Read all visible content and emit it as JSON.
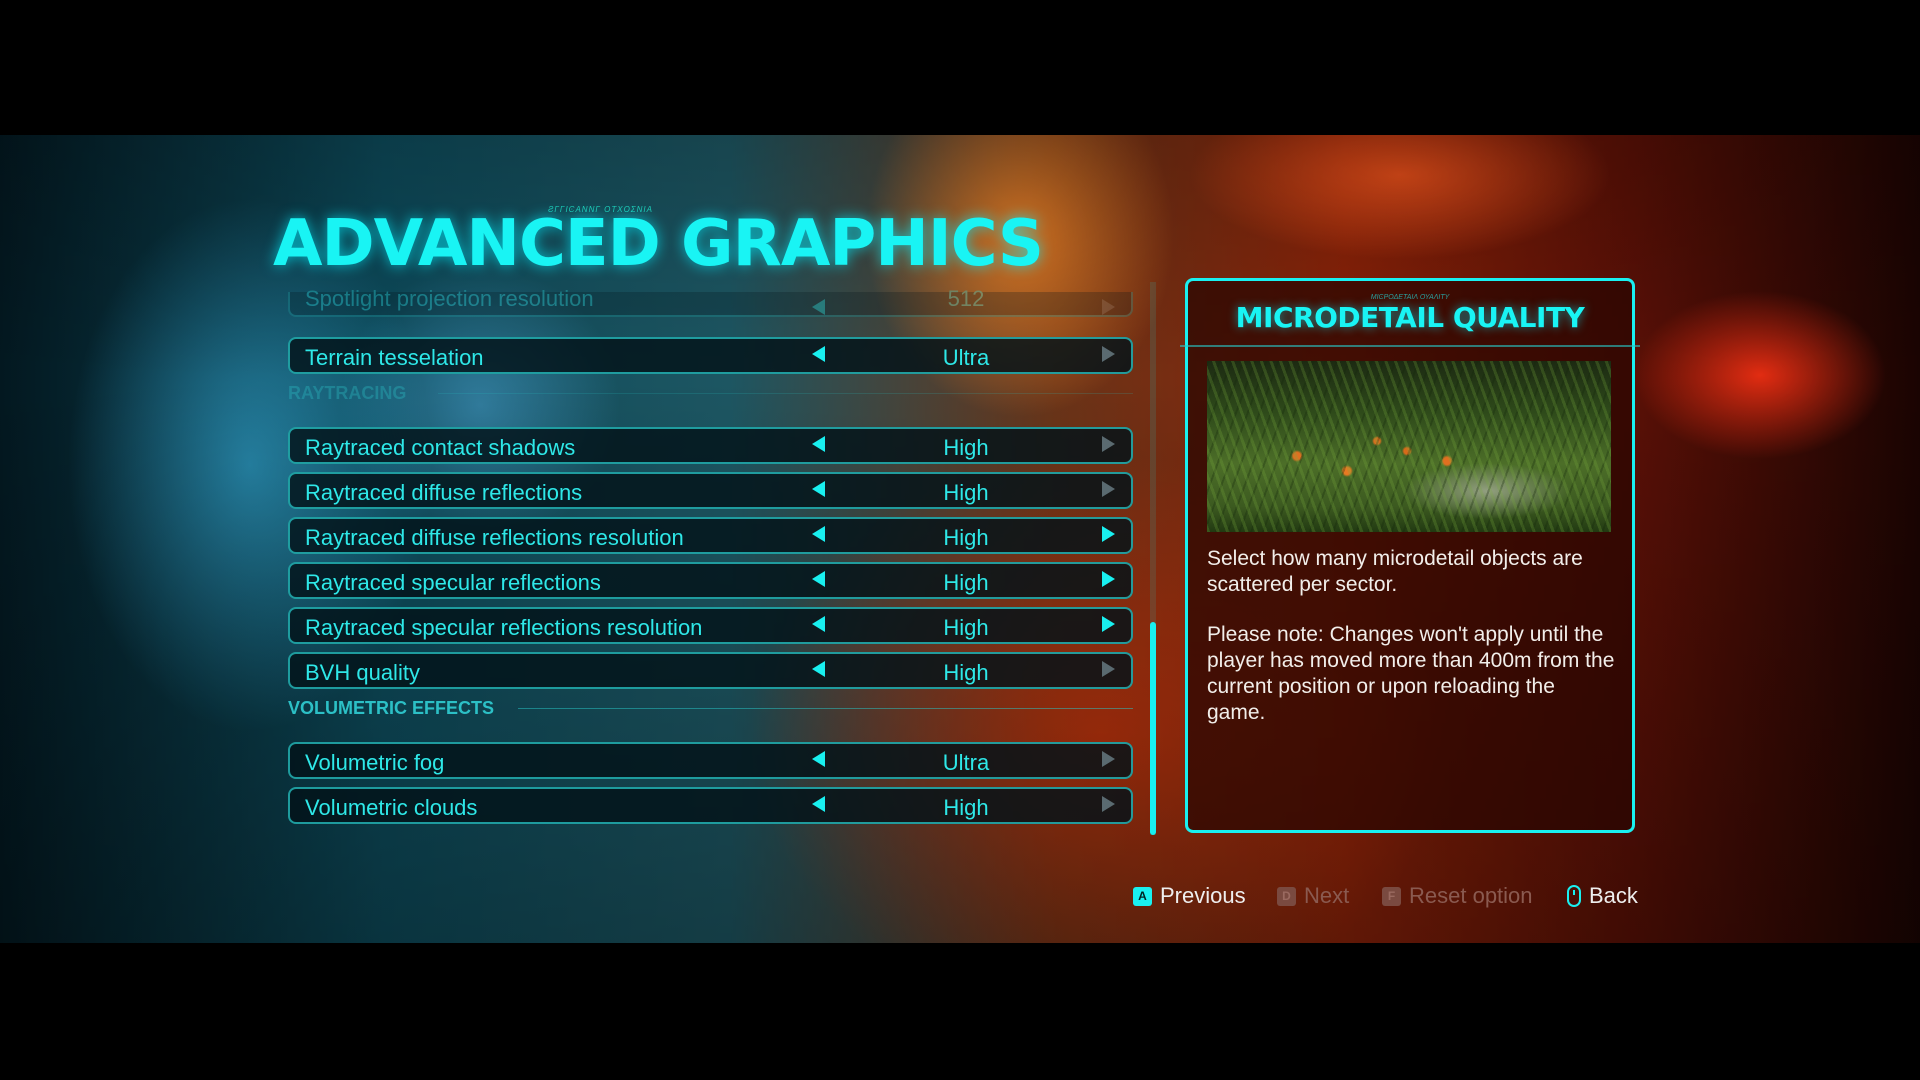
{
  "header": {
    "title": "ADVANCED GRAPHICS",
    "subtitle_glyphs": "ƧΓΓΙϾΑΝΝΓ ΟΤΧΟΣΝΙΑ"
  },
  "settings": {
    "partial_row": {
      "label": "Spotlight projection resolution",
      "value": "512"
    },
    "top_rows": [
      {
        "label": "Terrain tesselation",
        "value": "Ultra",
        "right_enabled": false
      }
    ],
    "sections": [
      {
        "title": "RAYTRACING",
        "rows": [
          {
            "label": "Raytraced contact shadows",
            "value": "High",
            "right_enabled": false
          },
          {
            "label": "Raytraced diffuse reflections",
            "value": "High",
            "right_enabled": false
          },
          {
            "label": "Raytraced diffuse reflections resolution",
            "value": "High",
            "right_enabled": true
          },
          {
            "label": "Raytraced specular reflections",
            "value": "High",
            "right_enabled": true
          },
          {
            "label": "Raytraced specular reflections resolution",
            "value": "High",
            "right_enabled": true
          },
          {
            "label": "BVH quality",
            "value": "High",
            "right_enabled": false
          }
        ]
      },
      {
        "title": "VOLUMETRIC EFFECTS",
        "rows": [
          {
            "label": "Volumetric fog",
            "value": "Ultra",
            "right_enabled": false
          },
          {
            "label": "Volumetric clouds",
            "value": "High",
            "right_enabled": false
          }
        ]
      }
    ]
  },
  "info_panel": {
    "glyphs": "ΜΙϾΡΟΔΕΤΑΙΛ ΟΥΑΛΙΤΥ",
    "title": "MICRODETAIL QUALITY",
    "image": "jungle-foliage-preview",
    "description": "Select how many microdetail objects are scattered per sector.",
    "note": "Please note: Changes won't apply until the player has moved more than 400m from the current position or upon reloading the game."
  },
  "footer": {
    "previous": {
      "key": "A",
      "label": "Previous"
    },
    "next": {
      "key": "D",
      "label": "Next"
    },
    "reset": {
      "key": "F",
      "label": "Reset option"
    },
    "back": {
      "icon": "mouse-icon",
      "label": "Back"
    }
  },
  "colors": {
    "accent": "#19f0f0",
    "text": "#2ee8e8",
    "disabled_arrow": "#5a6a70"
  }
}
